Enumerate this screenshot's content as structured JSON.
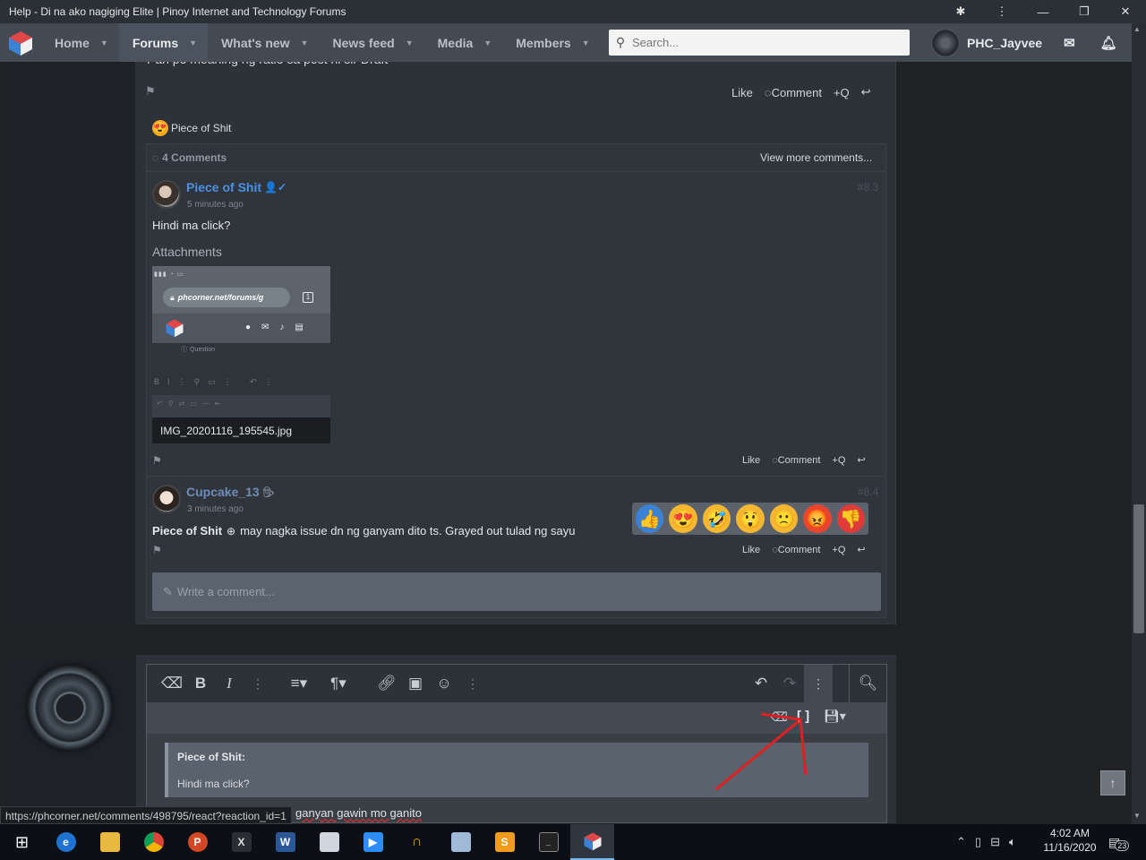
{
  "window": {
    "title": "Help - Di na ako nagiging Elite | Pinoy Internet and Technology Forums"
  },
  "nav": {
    "items": [
      {
        "label": "Home",
        "active": false
      },
      {
        "label": "Forums",
        "active": true
      },
      {
        "label": "What's new",
        "active": false
      },
      {
        "label": "News feed",
        "active": false
      },
      {
        "label": "Media",
        "active": false
      },
      {
        "label": "Members",
        "active": false
      }
    ],
    "search_placeholder": "Search...",
    "username": "PHC_Jayvee"
  },
  "post": {
    "cut_text": "Pan po meaning ng ratio sa post ni sir Draft",
    "actions": {
      "like": "Like",
      "comment": "Comment",
      "quote": "+Q"
    },
    "reaction_user": "Piece of Shit",
    "comments_count": "4 Comments",
    "view_more": "View more comments..."
  },
  "comments": [
    {
      "author": "Piece of Shit",
      "time": "5 minutes ago",
      "number": "#8.3",
      "text": "Hindi ma click?",
      "attachments_label": "Attachments",
      "attachment_name": "IMG_20201116_195545.jpg",
      "attachment_url_preview": "phcorner.net/forums/g",
      "attachment_preview_label": "Question",
      "actions": {
        "like": "Like",
        "comment": "Comment",
        "quote": "+Q"
      }
    },
    {
      "author": "Cupcake_13",
      "time": "3 minutes ago",
      "number": "#8.4",
      "mention": "Piece of Shit",
      "text": "may nagka issue dn ng ganyam dito ts. Grayed out tulad ng sayu",
      "actions": {
        "like": "Like",
        "comment": "Comment",
        "quote": "+Q"
      }
    }
  ],
  "write_comment_placeholder": "Write a comment...",
  "editor": {
    "quote_author": "Piece of Shit:",
    "quote_text": "Hindi ma click?",
    "body_visible_text": "ganyan gawin mo ganito"
  },
  "status_url": "https://phcorner.net/comments/498795/react?reaction_id=1",
  "taskbar": {
    "time": "4:02 AM",
    "date": "11/16/2020",
    "notif_count": "23"
  },
  "colors": {
    "nav_bg": "#434a54",
    "link": "#4d8fe8",
    "annotation_arrow": "#e02020"
  }
}
